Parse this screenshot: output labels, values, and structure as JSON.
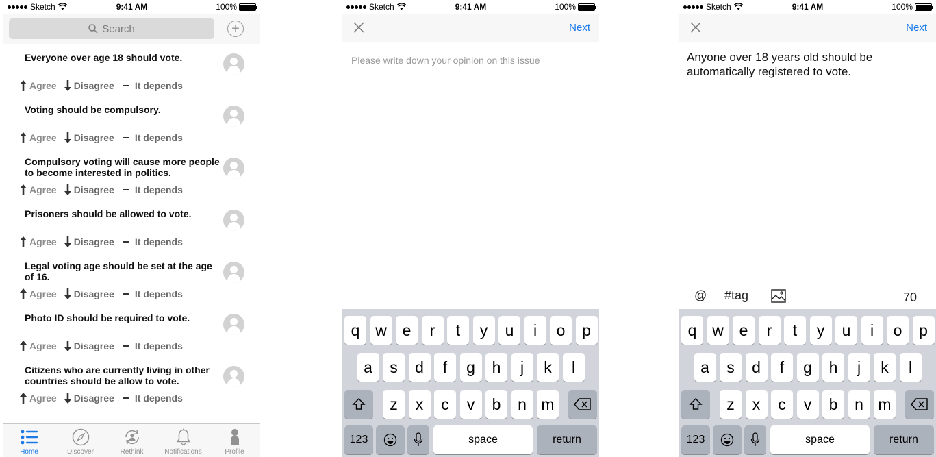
{
  "status_bar": {
    "carrier": "Sketch",
    "time": "9:41 AM",
    "battery": "100%"
  },
  "home": {
    "search": {
      "placeholder": "Search"
    },
    "issues": [
      {
        "statement": "Everyone over age 18 should vote."
      },
      {
        "statement": "Voting should be compulsory."
      },
      {
        "statement": "Compulsory voting will cause more people to become interested in politics."
      },
      {
        "statement": "Prisoners should be allowed to vote."
      },
      {
        "statement": "Legal voting age should be set at the age of 16."
      },
      {
        "statement": "Photo ID should be required to vote."
      },
      {
        "statement": "Citizens who are currently living in other countries should be allow to vote."
      }
    ],
    "actions": {
      "agree": "Agree",
      "disagree": "Disagree",
      "depends": "It depends"
    },
    "tabs": [
      {
        "label": "Home",
        "icon": "list-icon",
        "active": true
      },
      {
        "label": "Discover",
        "icon": "compass-icon",
        "active": false
      },
      {
        "label": "Rethink",
        "icon": "rethink-icon",
        "active": false
      },
      {
        "label": "Notifications",
        "icon": "bell-icon",
        "active": false
      },
      {
        "label": "Profile",
        "icon": "person-icon",
        "active": false
      }
    ]
  },
  "compose_empty": {
    "next_label": "Next",
    "placeholder": "Please write down your opinion on this issue"
  },
  "compose_filled": {
    "next_label": "Next",
    "text": "Anyone over 18 years old should be automatically registered to vote.",
    "toolbar": {
      "mention": "@",
      "tag": "#tag",
      "char_count": "70"
    }
  },
  "keyboard": {
    "row1": [
      "q",
      "w",
      "e",
      "r",
      "t",
      "y",
      "u",
      "i",
      "o",
      "p"
    ],
    "row2": [
      "a",
      "s",
      "d",
      "f",
      "g",
      "h",
      "j",
      "k",
      "l"
    ],
    "row3": [
      "z",
      "x",
      "c",
      "v",
      "b",
      "n",
      "m"
    ],
    "numbers": "123",
    "space": "space",
    "return": "return"
  },
  "colors": {
    "accent": "#1a7ae8",
    "keyboard_bg": "#d1d4da",
    "function_key": "#acb2bc"
  }
}
